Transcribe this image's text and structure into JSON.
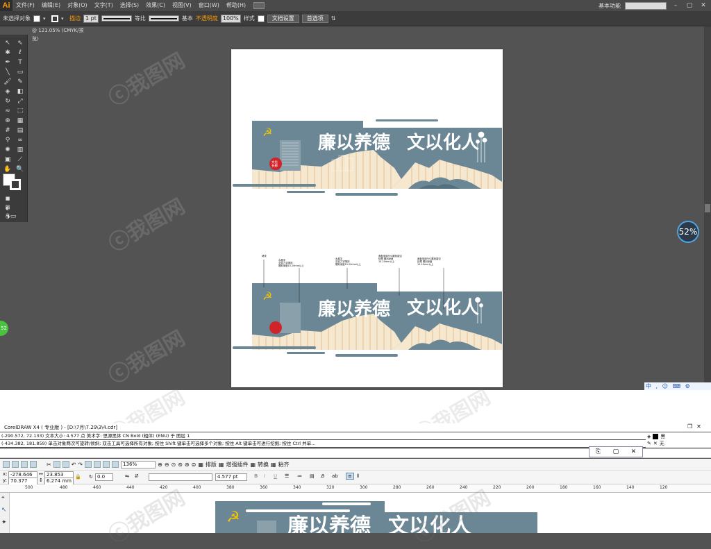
{
  "ai": {
    "logo": "Ai",
    "menu": [
      "文件(F)",
      "编辑(E)",
      "对象(O)",
      "文字(T)",
      "选择(S)",
      "效果(C)",
      "视图(V)",
      "窗口(W)",
      "帮助(H)"
    ],
    "workspace": "基本功能",
    "control": {
      "selection": "未选择对象",
      "stroke_label": "描边",
      "stroke_weight": "1 pt",
      "stroke_style1": "等比",
      "stroke_style2": "基本",
      "opacity_label": "不透明度",
      "opacity": "100%",
      "style_label": "样式",
      "doc_setup": "文档设置",
      "preferences": "首选项"
    },
    "doc_tab": "@ 121.05% (CMYK/预览)"
  },
  "artwork": {
    "title_left": "廉以养德",
    "title_right": "文以化人",
    "seal": "文化长廊",
    "annotations": [
      "烤漆",
      "水晶字\n亚克力字\n雕刻深度10-20mm",
      "水晶字\n亚克力字\n雕刻深度10-20mm",
      "面板采用PVC雕刻\n镂空处理\n雕刻深度10-20mm",
      "面板采用PVC雕刻\n镂空处理\n雕刻深度10-20mm"
    ]
  },
  "colors": {
    "panel": "#6b8694",
    "cream": "#f6e7cf",
    "stripe": "#d9b98c",
    "red": "#d0232a"
  },
  "badges": {
    "perf": "52%",
    "green": "52"
  },
  "ime": "中 , ☺ ⌨ ⚙",
  "coreldraw": {
    "title": "CorelDRAW X4 ( 专业版 ) - [D:\\7月\\7.29\\3\\4.cdr]",
    "status1": "(-290.572, 72.133)  文本大小: 4.577 点              美术字: 思源黑体 CN Bold (粗体) (ENU) 于 图层 1",
    "status2": "(-434.382, 181.859)  单击对象两次可旋转/倾斜; 双击工具可选择所有对象; 按住 Shift 键单击可选择多个对象; 按住 Alt 键单击可进行挖掘; 按住 Ctrl 并单...",
    "color_fill": "黑",
    "color_stroke": "无",
    "zoom": "136%",
    "toolbar_labels": [
      "排版",
      "增强插件",
      "转换",
      "粘齐"
    ],
    "x": "-278.646 mm",
    "y": "70.377 mm",
    "w": "23.853 mm",
    "h": "6.274 mm",
    "angle": "0.0",
    "font_size": "4.577 pt",
    "ruler_marks": [
      "500",
      "480",
      "460",
      "440",
      "420",
      "400",
      "380",
      "360",
      "340",
      "320",
      "300",
      "280",
      "260",
      "240",
      "220",
      "200",
      "180",
      "160",
      "140",
      "120"
    ]
  }
}
